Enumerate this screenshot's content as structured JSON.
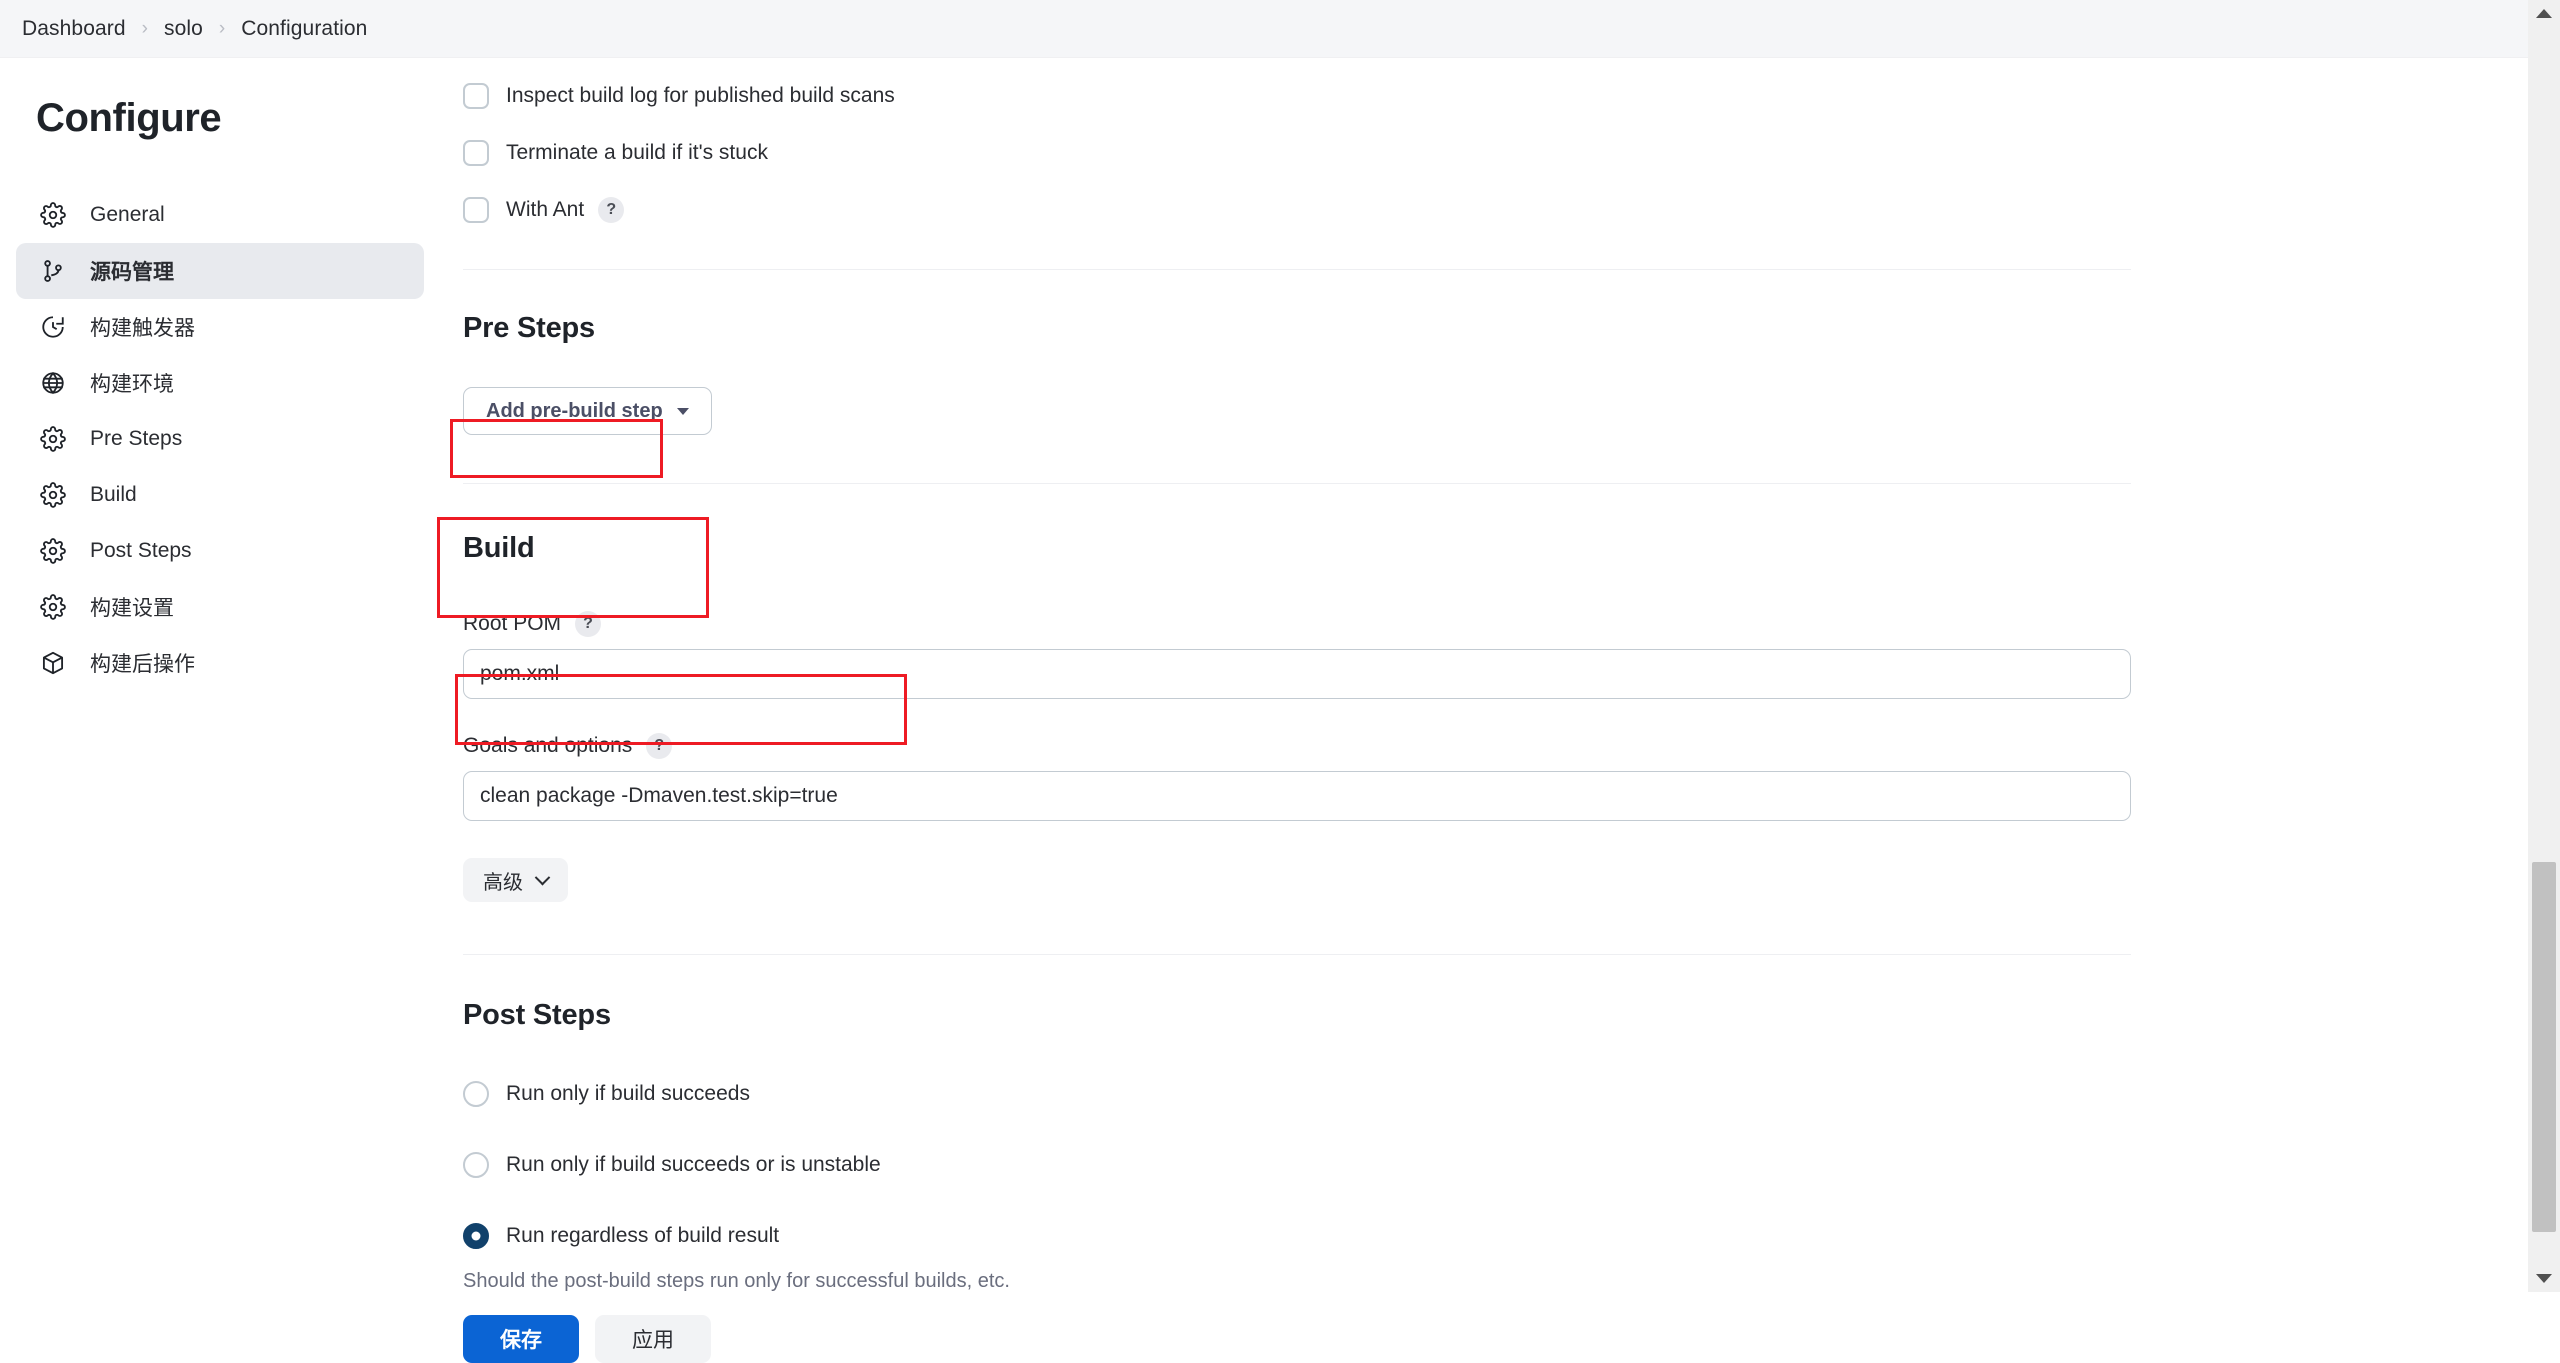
{
  "breadcrumb": {
    "items": [
      {
        "label": "Dashboard"
      },
      {
        "label": "solo"
      },
      {
        "label": "Configuration"
      }
    ],
    "separator": "›"
  },
  "sidebar": {
    "title": "Configure",
    "items": [
      {
        "label": "General",
        "icon": "gear-icon",
        "active": false
      },
      {
        "label": "源码管理",
        "icon": "branch-icon",
        "active": true
      },
      {
        "label": "构建触发器",
        "icon": "clock-icon",
        "active": false
      },
      {
        "label": "构建环境",
        "icon": "globe-icon",
        "active": false
      },
      {
        "label": "Pre Steps",
        "icon": "gear-icon",
        "active": false
      },
      {
        "label": "Build",
        "icon": "gear-icon",
        "active": false
      },
      {
        "label": "Post Steps",
        "icon": "gear-icon",
        "active": false
      },
      {
        "label": "构建设置",
        "icon": "gear-icon",
        "active": false
      },
      {
        "label": "构建后操作",
        "icon": "package-icon",
        "active": false
      }
    ]
  },
  "main": {
    "checkboxes": [
      {
        "label": "Inspect build log for published build scans",
        "checked": false,
        "help": false
      },
      {
        "label": "Terminate a build if it's stuck",
        "checked": false,
        "help": false
      },
      {
        "label": "With Ant",
        "checked": false,
        "help": true
      }
    ],
    "pre_steps": {
      "title": "Pre Steps",
      "add_button": "Add pre-build step"
    },
    "build": {
      "title": "Build",
      "root_pom": {
        "label": "Root POM",
        "value": "pom.xml",
        "help": "?"
      },
      "goals": {
        "label": "Goals and options",
        "value": "clean package -Dmaven.test.skip=true",
        "help": "?"
      },
      "advanced_button": "高级"
    },
    "post_steps": {
      "title": "Post Steps",
      "options": [
        {
          "label": "Run only if build succeeds",
          "selected": false
        },
        {
          "label": "Run only if build succeeds or is unstable",
          "selected": false
        },
        {
          "label": "Run regardless of build result",
          "selected": true
        }
      ],
      "hint": "Should the post-build steps run only for successful builds, etc."
    },
    "actions": {
      "save": "保存",
      "apply": "应用"
    }
  },
  "help_badge_text": "?",
  "colors": {
    "accent_blue": "#0b64d4",
    "radio_selected": "#11416b",
    "annotation_red": "#ee1b24",
    "sidebar_active_bg": "#e8eaee"
  }
}
